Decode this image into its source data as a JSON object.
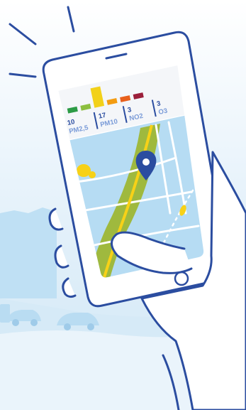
{
  "colors": {
    "outline": "#2b4da0",
    "background_sky": "#cfe6f5",
    "city_silhouette": "#a9d3ee",
    "map_water": "#b6dcf3",
    "map_green_corridor": "#9cb52a",
    "map_road_yellow": "#f7d117",
    "pin": "#2b4da0",
    "bar_green": "#2c9b45",
    "bar_lightgreen": "#8cbf3f",
    "bar_yellow": "#f2d11a",
    "bar_orange": "#f39c12",
    "bar_darkorange": "#e8601c",
    "bar_maroon": "#9b1f3a"
  },
  "air_quality": {
    "bars": [
      {
        "color": "#2c9b45",
        "level": 1
      },
      {
        "color": "#8cbf3f",
        "level": 1
      },
      {
        "color": "#f2d11a",
        "level": 4
      },
      {
        "color": "#f39c12",
        "level": 1
      },
      {
        "color": "#e8601c",
        "level": 1
      },
      {
        "color": "#9b1f3a",
        "level": 1
      }
    ],
    "readings": [
      {
        "value": "10",
        "label": "PM2,5"
      },
      {
        "value": "17",
        "label": "PM10"
      },
      {
        "value": "3",
        "label": "NO2"
      },
      {
        "value": "3",
        "label": "O3"
      }
    ]
  },
  "icons": {
    "location_pin": "map-pin-icon",
    "shine": "shine-lines-icon"
  }
}
